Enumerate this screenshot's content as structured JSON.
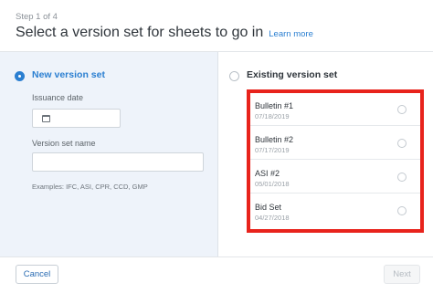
{
  "header": {
    "step": "Step 1 of 4",
    "title": "Select a version set for sheets to go in",
    "learn_more": "Learn more"
  },
  "new_set": {
    "label": "New version set",
    "selected": true,
    "issuance_label": "Issuance date",
    "issuance_value": "",
    "name_label": "Version set name",
    "name_value": "",
    "examples": "Examples: IFC, ASI, CPR, CCD, GMP",
    "calendar_icon": "calendar-icon"
  },
  "existing_set": {
    "label": "Existing version set",
    "selected": false,
    "items": [
      {
        "name": "Bulletin #1",
        "date": "07/18/2019"
      },
      {
        "name": "Bulletin #2",
        "date": "07/17/2019"
      },
      {
        "name": "ASI #2",
        "date": "05/01/2018"
      },
      {
        "name": "Bid Set",
        "date": "04/27/2018"
      }
    ]
  },
  "footer": {
    "cancel": "Cancel",
    "next": "Next"
  },
  "colors": {
    "accent": "#2b7fd1",
    "highlight_border": "#e8231c",
    "left_panel_bg": "#eef3fa"
  }
}
